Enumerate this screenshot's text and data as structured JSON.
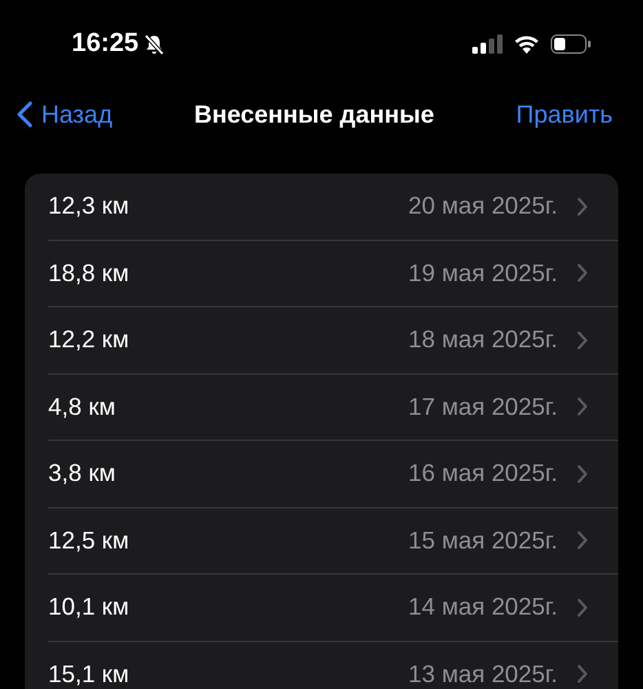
{
  "status_bar": {
    "time": "16:25",
    "silent": true
  },
  "nav": {
    "back": "Назад",
    "title": "Внесенные данные",
    "action": "Править"
  },
  "entries": [
    {
      "distance": "12,3 км",
      "date": "20 мая 2025г."
    },
    {
      "distance": "18,8 км",
      "date": "19 мая 2025г."
    },
    {
      "distance": "12,2 км",
      "date": "18 мая 2025г."
    },
    {
      "distance": "4,8 км",
      "date": "17 мая 2025г."
    },
    {
      "distance": "3,8 км",
      "date": "16 мая 2025г."
    },
    {
      "distance": "12,5 км",
      "date": "15 мая 2025г."
    },
    {
      "distance": "10,1 км",
      "date": "14 мая 2025г."
    },
    {
      "distance": "15,1 км",
      "date": "13 мая 2025г."
    }
  ]
}
